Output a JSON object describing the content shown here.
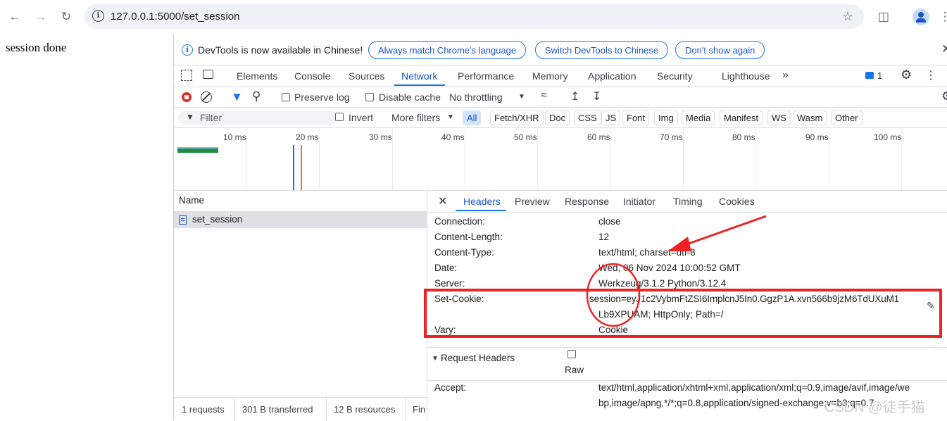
{
  "browser": {
    "url": "127.0.0.1:5000/set_session"
  },
  "page": {
    "text": "session done"
  },
  "devtools": {
    "infobar": {
      "message": "DevTools is now available in Chinese!",
      "buttons": [
        "Always match Chrome's language",
        "Switch DevTools to Chinese",
        "Don't show again"
      ]
    },
    "tabs": [
      "Elements",
      "Console",
      "Sources",
      "Network",
      "Performance",
      "Memory",
      "Application",
      "Security",
      "Lighthouse"
    ],
    "active_tab": "Network",
    "issues_count": "1",
    "controls": {
      "preserve_log": "Preserve log",
      "disable_cache": "Disable cache",
      "throttling": "No throttling"
    },
    "filter": {
      "placeholder": "Filter",
      "invert": "Invert",
      "more_filters": "More filters",
      "types": [
        "All",
        "Fetch/XHR",
        "Doc",
        "CSS",
        "JS",
        "Font",
        "Img",
        "Media",
        "Manifest",
        "WS",
        "Wasm",
        "Other"
      ]
    },
    "timeline_ticks": [
      "10 ms",
      "20 ms",
      "30 ms",
      "40 ms",
      "50 ms",
      "60 ms",
      "70 ms",
      "80 ms",
      "90 ms",
      "100 ms"
    ],
    "requests": {
      "column_name": "Name",
      "items": [
        "set_session"
      ]
    },
    "status": {
      "requests": "1 requests",
      "transferred": "301 B transferred",
      "resources": "12 B resources",
      "finish": "Fin"
    },
    "detail_tabs": [
      "Headers",
      "Preview",
      "Response",
      "Initiator",
      "Timing",
      "Cookies"
    ],
    "response_headers": [
      {
        "name": "Connection:",
        "value": "close"
      },
      {
        "name": "Content-Length:",
        "value": "12"
      },
      {
        "name": "Content-Type:",
        "value": "text/html; charset=utf-8"
      },
      {
        "name": "Date:",
        "value": "Wed, 06 Nov 2024 10:00:52 GMT"
      },
      {
        "name": "Server:",
        "value": "Werkzeug/3.1.2 Python/3.12.4"
      },
      {
        "name": "Set-Cookie:",
        "value_line1": "session=eyJ1c2VybmFtZSI6ImplcnJ5In0.GgzP1A.xvn566b9jzM6TdUXuM1",
        "value_line2": "Lb9XPUAM; HttpOnly; Path=/"
      },
      {
        "name": "Vary:",
        "value": "Cookie"
      }
    ],
    "request_headers": {
      "title": "Request Headers",
      "raw": "Raw",
      "accept_name": "Accept:",
      "accept_line1": "text/html,application/xhtml+xml,application/xml;q=0.9,image/avif,image/we",
      "accept_line2": "bp,image/apng,*/*;q=0.8,application/signed-exchange;v=b3;q=0.7"
    }
  },
  "watermark": "CSDN @徒手猫",
  "colors": {
    "accent": "#1a73e8",
    "annotation": "#ee2222"
  }
}
